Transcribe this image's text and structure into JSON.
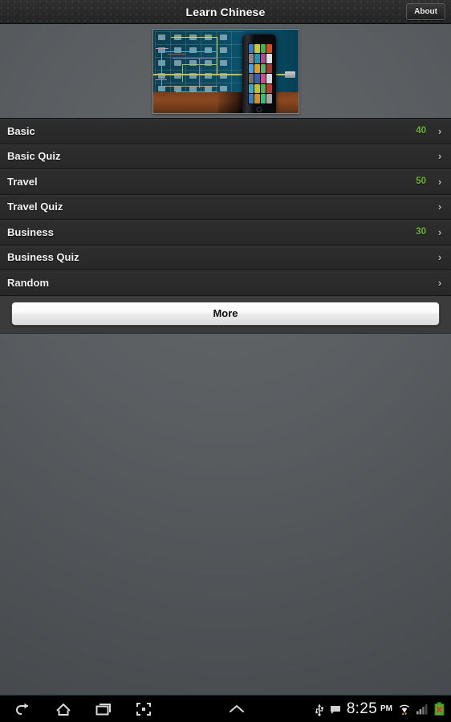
{
  "titlebar": {
    "title": "Learn Chinese",
    "about_label": "About"
  },
  "banner": {
    "alt": "promo-banner-phone-network"
  },
  "list": {
    "rows": [
      {
        "label": "Basic",
        "count": "40",
        "chevron": "›"
      },
      {
        "label": "Basic Quiz",
        "count": "",
        "chevron": "›"
      },
      {
        "label": "Travel",
        "count": "50",
        "chevron": "›"
      },
      {
        "label": "Travel Quiz",
        "count": "",
        "chevron": "›"
      },
      {
        "label": "Business",
        "count": "30",
        "chevron": "›"
      },
      {
        "label": "Business Quiz",
        "count": "",
        "chevron": "›"
      },
      {
        "label": "Random",
        "count": "",
        "chevron": "›"
      }
    ]
  },
  "footer": {
    "more_label": "More"
  },
  "systembar": {
    "nav": [
      {
        "name": "back-icon"
      },
      {
        "name": "home-icon"
      },
      {
        "name": "recent-apps-icon"
      },
      {
        "name": "screenshot-icon"
      },
      {
        "name": "chevron-up-icon"
      }
    ],
    "status": {
      "usb_icon": "usb-icon",
      "message_icon": "message-icon",
      "time": "8:25",
      "ampm": "PM",
      "wifi_icon": "wifi-icon",
      "signal_icon": "signal-icon",
      "battery_icon": "battery-error-icon"
    }
  },
  "colors": {
    "accent_green": "#6fb22e",
    "page_background": "#565a5e",
    "titlebar": "#2b2b2b",
    "row_background": "#2e2e2e",
    "banner_teal": "#0c4356",
    "banner_floor": "#8a4a22"
  }
}
